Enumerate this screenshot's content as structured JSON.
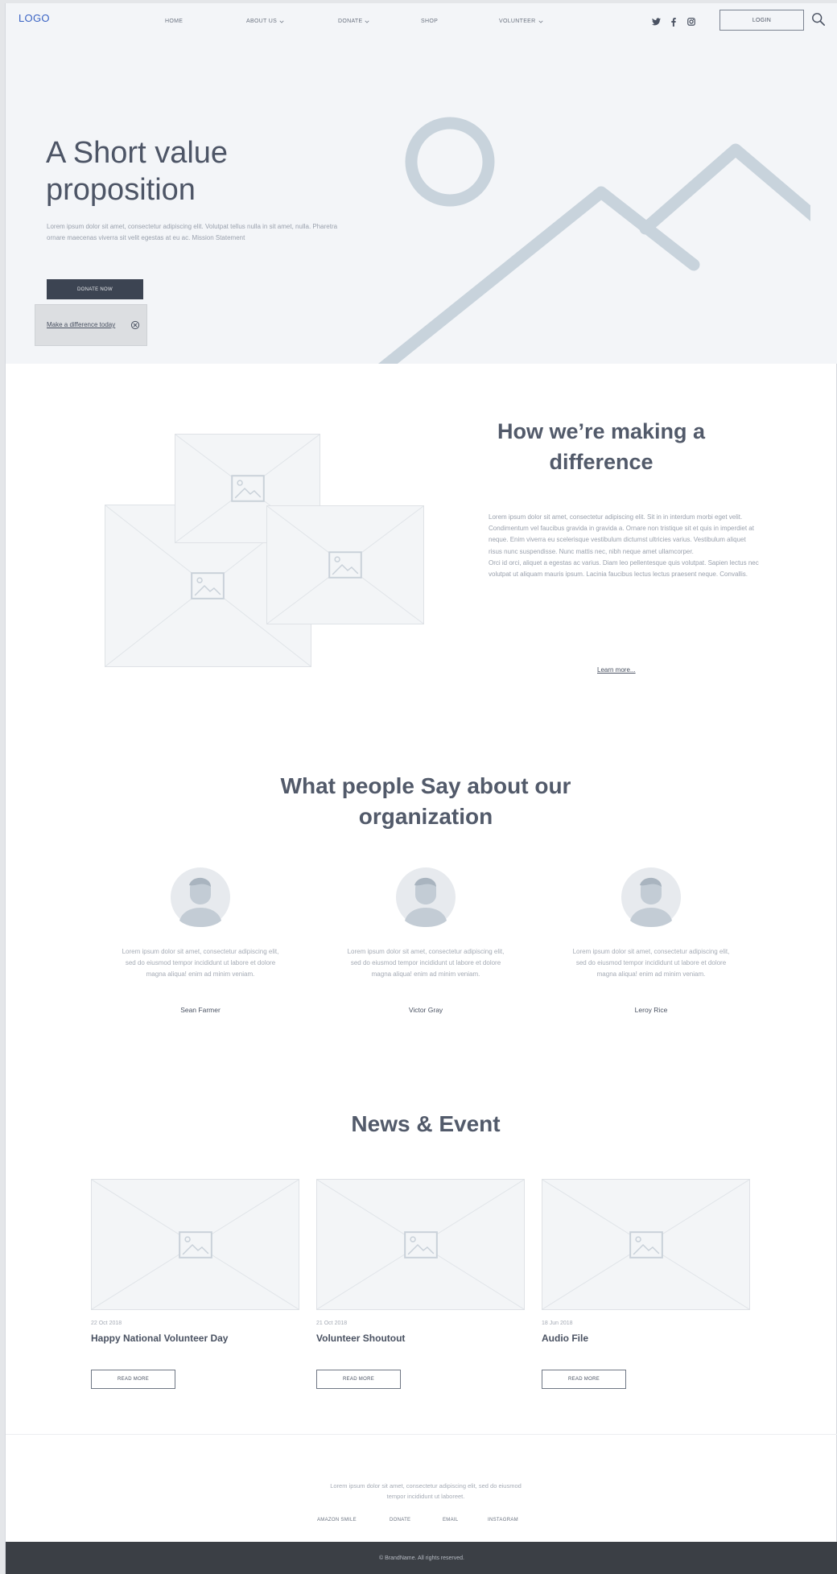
{
  "header": {
    "logo": "LOGO",
    "nav": [
      {
        "label": "HOME",
        "dropdown": false
      },
      {
        "label": "ABOUT US",
        "dropdown": true
      },
      {
        "label": "DONATE",
        "dropdown": true
      },
      {
        "label": "SHOP",
        "dropdown": false
      },
      {
        "label": "VOLUNTEER",
        "dropdown": true
      }
    ],
    "social_icons": [
      "twitter-icon",
      "facebook-icon",
      "instagram-icon"
    ],
    "login_label": "LOGIN",
    "search_icon": "search-icon"
  },
  "hero": {
    "title": "A Short value proposition",
    "text": "Lorem ipsum dolor sit amet, consectetur adipiscing elit. Volutpat tellus nulla in sit amet, nulla. Pharetra ornare maecenas viverra sit velit egestas at eu ac. Mission Statement",
    "donate_label": "DONATE NOW",
    "toast_link": "Make a difference today",
    "toast_close_icon": "close-circle-icon",
    "image_icon": "mountain-image-icon"
  },
  "difference": {
    "title": "How we’re making a difference",
    "text": "Lorem ipsum dolor sit amet, consectetur adipiscing elit. Sit in in interdum morbi eget velit. Condimentum vel faucibus gravida in gravida a. Ornare non tristique sit et quis in imperdiet at neque. Enim viverra eu scelerisque vestibulum dictumst ultricies varius. Vestibulum aliquet risus nunc suspendisse. Nunc mattis nec, nibh neque amet ullamcorper.\nOrci id orci, aliquet a egestas ac varius. Diam leo pellentesque quis volutpat. Sapien lectus nec volutpat ut aliquam mauris ipsum. Lacinia faucibus lectus lectus praesent neque. Convallis.",
    "learn_more": "Learn more..."
  },
  "testimonials": {
    "title": "What people Say about our organization",
    "items": [
      {
        "quote": "Lorem ipsum dolor sit amet, consectetur adipiscing elit, sed do eiusmod tempor incididunt ut labore et dolore magna aliqua! enim ad minim veniam.",
        "name": "Sean Farmer"
      },
      {
        "quote": "Lorem ipsum dolor sit amet, consectetur adipiscing elit, sed do eiusmod tempor incididunt ut labore et dolore magna aliqua! enim ad minim veniam.",
        "name": "Victor Gray"
      },
      {
        "quote": "Lorem ipsum dolor sit amet, consectetur adipiscing elit, sed do eiusmod tempor incididunt ut labore et dolore magna aliqua! enim ad minim veniam.",
        "name": "Leroy Rice"
      }
    ]
  },
  "news": {
    "title": "News & Event",
    "items": [
      {
        "date": "22 Oct 2018",
        "title": "Happy National Volunteer Day",
        "button": "READ MORE"
      },
      {
        "date": "21 Oct 2018",
        "title": "Volunteer Shoutout",
        "button": "READ MORE"
      },
      {
        "date": "18 Jun 2018",
        "title": "Audio File",
        "button": "READ MORE"
      }
    ]
  },
  "footer": {
    "text": "Lorem ipsum dolor sit amet, consectetur adipiscing elit, sed do eiusmod tempor incididunt ut laboreet.",
    "links": [
      "AMAZON SMILE",
      "DONATE",
      "EMAIL",
      "INSTAGRAM"
    ],
    "copyright": "© BrandName. All rights reserved."
  },
  "colors": {
    "accent_logo": "#3a63c4",
    "dark": "#3c4452",
    "hero_bg": "#f3f5f8",
    "footer_bar": "#3b3f45"
  }
}
